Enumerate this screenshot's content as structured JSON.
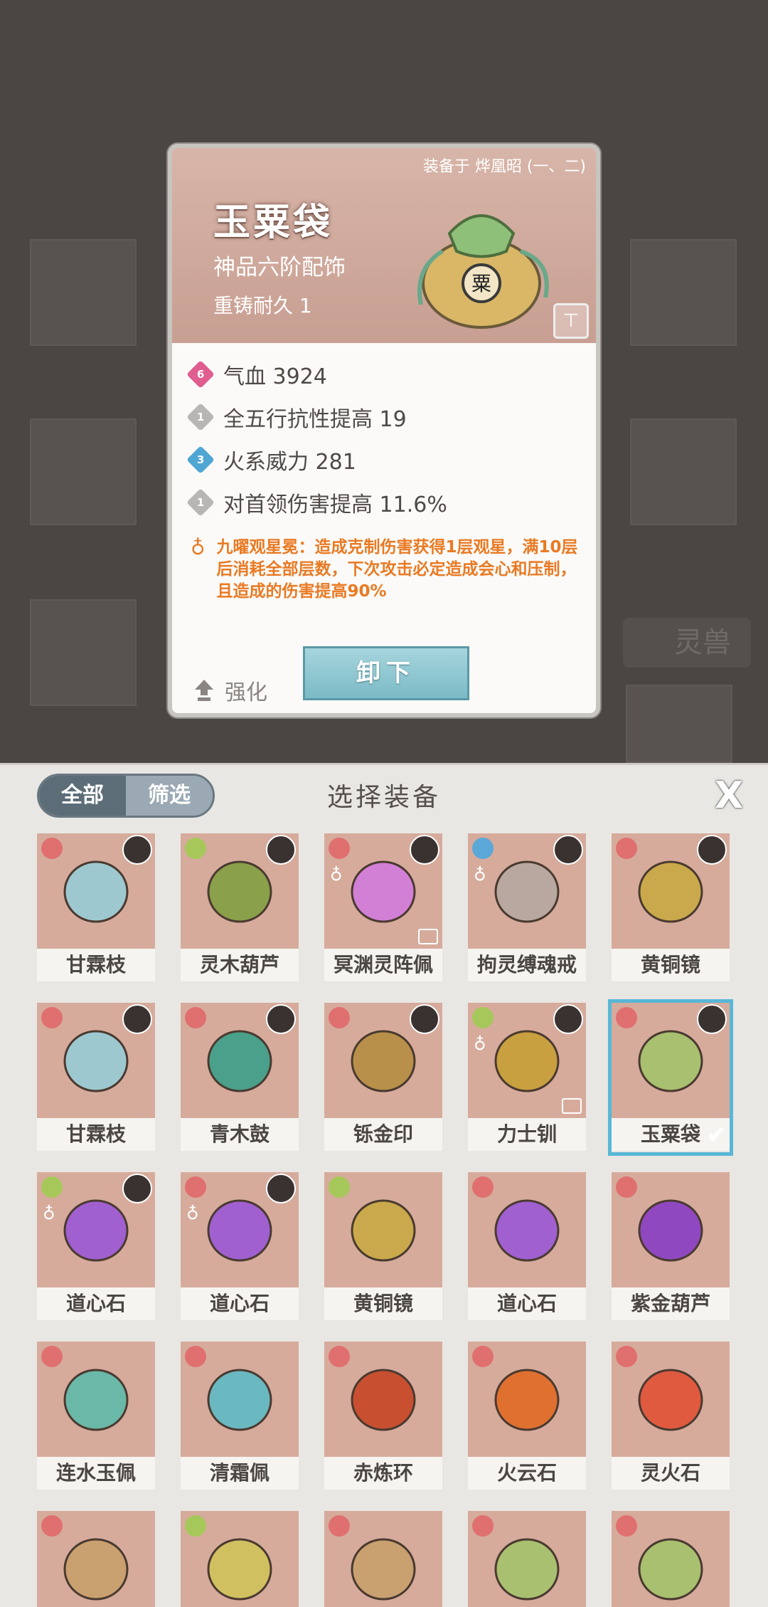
{
  "background": {
    "side_tab": "灵兽"
  },
  "detail": {
    "equipped_to": "装备于 烨凰昭 (一、二)",
    "name": "玉粟袋",
    "grade": "神品六阶配饰",
    "durability": "重铸耐久 1",
    "stats": [
      {
        "level": "6",
        "text": "气血 3924",
        "color": "#e05d8f"
      },
      {
        "level": "1",
        "text": "全五行抗性提高 19",
        "color": "#b8b6b4"
      },
      {
        "level": "3",
        "text": "火系威力 281",
        "color": "#4fa6d3"
      },
      {
        "level": "1",
        "text": "对首领伤害提高 11.6%",
        "color": "#b8b6b4"
      }
    ],
    "special": "九曜观星冕：造成克制伤害获得1层观星，满10层后消耗全部层数，下次攻击必定造成会心和压制，且造成的伤害提高90%",
    "upgrade_label": "强化",
    "unequip_label": "卸下"
  },
  "panel": {
    "tab_all": "全部",
    "tab_filter": "筛选",
    "title": "选择装备",
    "close": "X",
    "items": [
      {
        "name": "甘霖枝",
        "element": "#e07070",
        "color": "#9ec8d0"
      },
      {
        "name": "灵木葫芦",
        "element": "#a6c85a",
        "color": "#8aa04a"
      },
      {
        "name": "冥渊灵阵佩",
        "element": "#e07070",
        "color": "#d27fd6",
        "fx": true,
        "lock": true
      },
      {
        "name": "拘灵缚魂戒",
        "element": "#5aa8d8",
        "color": "#b8a8a0",
        "fx": true
      },
      {
        "name": "黄铜镜",
        "element": "#e07070",
        "color": "#c9a94b"
      },
      {
        "name": "甘霖枝",
        "element": "#e07070",
        "color": "#9ec8d0"
      },
      {
        "name": "青木鼓",
        "element": "#e07070",
        "color": "#4aa08a"
      },
      {
        "name": "铄金印",
        "element": "#e07070",
        "color": "#b8904a"
      },
      {
        "name": "力士钏",
        "element": "#a6c85a",
        "color": "#c8a040",
        "fx": true,
        "lock": true
      },
      {
        "name": "玉粟袋",
        "element": "#e07070",
        "color": "#a8c070",
        "selected": true
      },
      {
        "name": "道心石",
        "element": "#a6c85a",
        "color": "#a060d0",
        "fx": true
      },
      {
        "name": "道心石",
        "element": "#e07070",
        "color": "#a060d0",
        "fx": true
      },
      {
        "name": "黄铜镜",
        "element": "#a6c85a",
        "color": "#c9a94b"
      },
      {
        "name": "道心石",
        "element": "#e07070",
        "color": "#a060d0"
      },
      {
        "name": "紫金葫芦",
        "element": "#e07070",
        "color": "#9048c0"
      },
      {
        "name": "连水玉佩",
        "element": "#e07070",
        "color": "#6ab8a8"
      },
      {
        "name": "清霜佩",
        "element": "#e07070",
        "color": "#6ab8c0"
      },
      {
        "name": "赤炼环",
        "element": "#e07070",
        "color": "#c85030"
      },
      {
        "name": "火云石",
        "element": "#e07070",
        "color": "#e07030"
      },
      {
        "name": "灵火石",
        "element": "#e07070",
        "color": "#e05a40"
      },
      {
        "name": "",
        "element": "#e07070",
        "color": "#c9a070"
      },
      {
        "name": "",
        "element": "#a6c85a",
        "color": "#d0c060"
      },
      {
        "name": "",
        "element": "#e07070",
        "color": "#c9a070"
      },
      {
        "name": "",
        "element": "#e07070",
        "color": "#a8c070"
      },
      {
        "name": "",
        "element": "#e07070",
        "color": "#a8c070"
      }
    ]
  }
}
